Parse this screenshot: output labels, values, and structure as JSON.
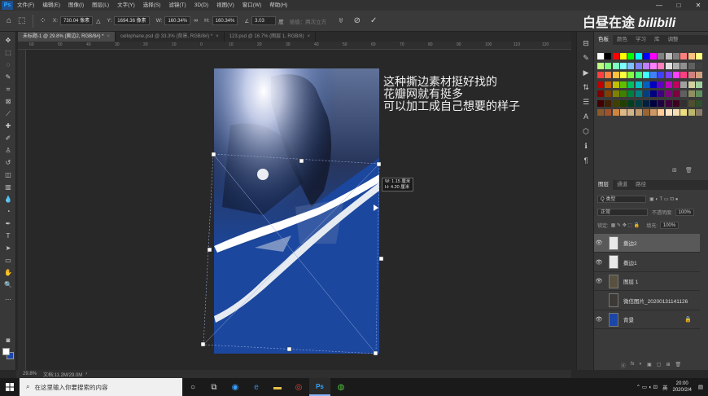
{
  "menu": {
    "items": [
      "文件(F)",
      "编辑(E)",
      "图像(I)",
      "图层(L)",
      "文字(Y)",
      "选择(S)",
      "滤镜(T)",
      "3D(D)",
      "视图(V)",
      "窗口(W)",
      "帮助(H)"
    ],
    "app_logo": "Ps",
    "window_controls": [
      "—",
      "□",
      "✕"
    ]
  },
  "options_bar": {
    "x_label": "X:",
    "x_value": "730.04 像素",
    "y_label": "Y:",
    "y_value": "1694.36 像素",
    "w_label": "W:",
    "w_value": "160.34%",
    "h_label": "H:",
    "h_value": "160.34%",
    "angle_label": "∠",
    "angle_value": "3.03",
    "interp_label": "度",
    "interp_hint": "插值：两次立方",
    "cancel_label": "⊘",
    "commit_label": "✓"
  },
  "doc_tabs": [
    {
      "label": "未标题-1 @ 29.8% (撕边2, RGB/8#) *",
      "close": "×"
    },
    {
      "label": "cellophane.psd @ 33.3% (背景, RGB/8#) *",
      "close": "×"
    },
    {
      "label": "123.psd @ 16.7% (图层 1, RGB/8)",
      "close": "×"
    }
  ],
  "ruler_ticks": [
    "60",
    "50",
    "40",
    "30",
    "20",
    "10",
    "0",
    "10",
    "20",
    "30",
    "40",
    "50",
    "60",
    "70",
    "80",
    "90",
    "100",
    "110",
    "120"
  ],
  "canvas": {
    "caption": "这种撕边素材挺好找的\n花瓣网就有挺多\n可以加工成自己想要的样子",
    "measure_line1": "W: 1.15 厘米",
    "measure_line2": "H: 4.20 厘米"
  },
  "status": {
    "zoom": "29.8%",
    "doc_info": "文档:11.2M/29.0M",
    "arrow": "›"
  },
  "watermark": {
    "text": "白昼在途",
    "logo": "bilibili"
  },
  "panels": {
    "swatch_tabs": [
      "色板",
      "颜色",
      "学习",
      "库",
      "调整"
    ],
    "layer_tabs": [
      "图层",
      "通道",
      "路径"
    ],
    "filter_label": "Q 类型",
    "blend_mode": "正常",
    "opacity_label": "不透明度:",
    "opacity_value": "100%",
    "lock_label": "锁定:",
    "fill_label": "填充:",
    "fill_value": "100%",
    "layers": [
      {
        "name": "撕边2",
        "visible": true,
        "selected": true,
        "thumb": "#e8e8e8",
        "locked": false
      },
      {
        "name": "撕边1",
        "visible": true,
        "selected": false,
        "thumb": "#e8e8e8",
        "locked": false
      },
      {
        "name": "图层 1",
        "visible": true,
        "selected": false,
        "thumb": "#5a5040",
        "locked": false
      },
      {
        "name": "微信图片_20200131141126",
        "visible": false,
        "selected": false,
        "thumb": "#3d3a36",
        "locked": false
      },
      {
        "name": "背景",
        "visible": true,
        "selected": false,
        "thumb": "#1b47a8",
        "locked": true
      }
    ],
    "footer_icons": [
      "ⓞ",
      "fx",
      "◐",
      "▣",
      "▢",
      "⊞",
      "🗑"
    ]
  },
  "swatches": [
    "#ffffff",
    "#000000",
    "#ff0000",
    "#ffff00",
    "#00ff00",
    "#00ffff",
    "#0000ff",
    "#ff00ff",
    "#808080",
    "#c0c0c0",
    "#7f7f7f",
    "#ff7f7f",
    "#ffbf7f",
    "#ffff7f",
    "#bfff7f",
    "#7fff7f",
    "#7fffbf",
    "#7fffff",
    "#7fbfff",
    "#7f7fff",
    "#bf7fff",
    "#ff7fff",
    "#ff7fbf",
    "#e0e0e0",
    "#b0b0b0",
    "#909090",
    "#606060",
    "#404040",
    "#ff4040",
    "#ff8040",
    "#ffc040",
    "#ffff40",
    "#80ff40",
    "#40ff80",
    "#40ffff",
    "#4080ff",
    "#4040ff",
    "#8040ff",
    "#ff40ff",
    "#ff4080",
    "#d08080",
    "#d0a080",
    "#c00000",
    "#c06000",
    "#c0c000",
    "#60c000",
    "#00c060",
    "#00c0c0",
    "#0060c0",
    "#0000c0",
    "#6000c0",
    "#c000c0",
    "#c00060",
    "#a0a0a0",
    "#d0d0a0",
    "#a0d0a0",
    "#800000",
    "#804000",
    "#808000",
    "#408000",
    "#008040",
    "#008080",
    "#004080",
    "#000080",
    "#400080",
    "#800080",
    "#800040",
    "#606060",
    "#909060",
    "#609060",
    "#400000",
    "#402000",
    "#404000",
    "#204000",
    "#004020",
    "#004040",
    "#002040",
    "#000040",
    "#200040",
    "#400040",
    "#400020",
    "#303030",
    "#505030",
    "#305030",
    "#8b5a2b",
    "#a0522d",
    "#cd853f",
    "#deb887",
    "#d2b48c",
    "#c19a6b",
    "#996633",
    "#cc9966",
    "#ffcc99",
    "#ffe4c4",
    "#f5deb3",
    "#eedd82",
    "#bdb76b",
    "#8b7d6b"
  ],
  "taskbar": {
    "search_placeholder": "在这里输入你要搜索的内容",
    "apps": [
      "○",
      "⧉",
      "◉",
      "e",
      "▬",
      "◎",
      "Ps",
      "◍"
    ],
    "tray_text": "英",
    "time": "20:00",
    "date": "2020/2/4"
  }
}
